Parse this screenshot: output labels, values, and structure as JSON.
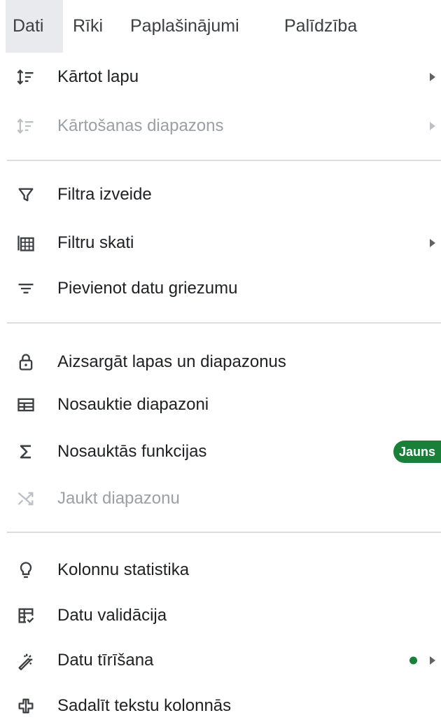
{
  "menubar": {
    "tabs": [
      {
        "label": "Dati",
        "active": true
      },
      {
        "label": "Rīki"
      },
      {
        "label": "Paplašinājumi"
      },
      {
        "label": "Palīdzība"
      }
    ]
  },
  "menu": {
    "sort_sheet": {
      "label": "Kārtot lapu",
      "icon": "sort-icon"
    },
    "sort_range": {
      "label": "Kārtošanas diapazons",
      "icon": "sort-icon",
      "disabled": true
    },
    "create_filter": {
      "label": "Filtra izveide",
      "icon": "filter-icon"
    },
    "filter_views": {
      "label": "Filtru skati",
      "icon": "filter-views-icon"
    },
    "add_slicer": {
      "label": "Pievienot datu griezumu",
      "icon": "slicer-icon"
    },
    "protect": {
      "label": "Aizsargāt lapas un diapazonus",
      "icon": "lock-icon"
    },
    "named_ranges": {
      "label": "Nosauktie diapazoni",
      "icon": "named-ranges-icon"
    },
    "named_functions": {
      "label": "Nosauktās funkcijas",
      "icon": "sigma-icon",
      "badge": "Jauns"
    },
    "randomize": {
      "label": "Jaukt diapazonu",
      "icon": "shuffle-icon",
      "disabled": true
    },
    "column_stats": {
      "label": "Kolonnu statistika",
      "icon": "lightbulb-icon"
    },
    "data_validation": {
      "label": "Datu validācija",
      "icon": "data-validation-icon"
    },
    "data_cleanup": {
      "label": "Datu tīrīšana",
      "icon": "magic-wand-icon"
    },
    "split_text": {
      "label": "Sadalīt tekstu kolonnās",
      "icon": "split-columns-icon"
    }
  },
  "colors": {
    "accent_green": "#188038",
    "text": "#202124",
    "disabled": "#9aa0a6"
  }
}
